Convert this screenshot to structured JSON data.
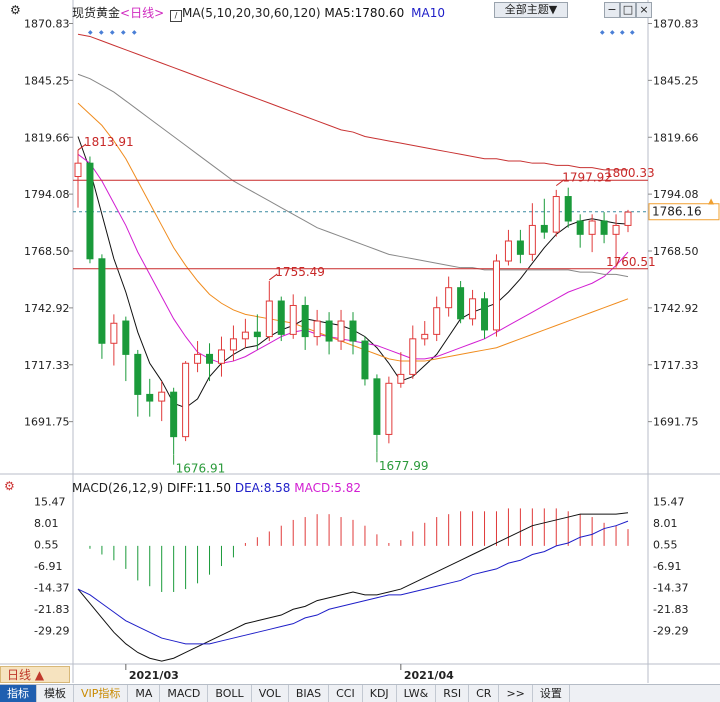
{
  "header": {
    "symbol": "现货黄金",
    "period": "<日线>",
    "ma_label": "MA(5,10,20,30,60,120)",
    "ma5_label": "MA5:1780.60",
    "ma10_label": "MA10",
    "theme_button": "全部主题▼"
  },
  "macd_header": {
    "name": "MACD(26,12,9)",
    "diff": "DIFF:11.50",
    "dea": "DEA:8.58",
    "macd": "MACD:5.82"
  },
  "period_button": "日线",
  "tabs": [
    "指标",
    "模板",
    "VIP指标",
    "MA",
    "MACD",
    "BOLL",
    "VOL",
    "BIAS",
    "CCI",
    "KDJ",
    "LW&",
    "RSI",
    "CR",
    ">>",
    "设置"
  ],
  "colors": {
    "up": "#e03a3a",
    "down": "#1a9a3a",
    "ma5": "#111111",
    "ma10": "#d21ed2",
    "ma20": "#f08c1e",
    "ma60": "#888888",
    "ma120": "#c83232",
    "dea": "#1e1ec8",
    "diff": "#111111"
  },
  "chart_data": [
    {
      "type": "candlestick",
      "title": "现货黄金 日线",
      "y_ticks_left": [
        "1870.83",
        "1845.25",
        "1819.66",
        "1794.08",
        "1768.50",
        "1742.92",
        "1717.33",
        "1691.75"
      ],
      "y_ticks_right": [
        "1870.83",
        "1845.25",
        "1819.66",
        "1794.08",
        "1768.50",
        "1742.92",
        "1717.33",
        "1691.75"
      ],
      "ylim": [
        1670,
        1876
      ],
      "x_labels": [
        {
          "label": "2021/03",
          "index": 4
        },
        {
          "label": "2021/04",
          "index": 27
        }
      ],
      "last_price": "1786.16",
      "horizontal_lines": [
        {
          "label": "1800.33",
          "value": 1800.33
        },
        {
          "label": "1760.51",
          "value": 1760.51
        }
      ],
      "annotations": [
        {
          "label": "1813.91",
          "index": 0,
          "value": 1813.91
        },
        {
          "label": "1755.49",
          "index": 16,
          "value": 1755.49
        },
        {
          "label": "1676.91",
          "index": 8,
          "value": 1676.91
        },
        {
          "label": "1677.99",
          "index": 25,
          "value": 1677.99
        },
        {
          "label": "1797.92",
          "index": 40,
          "value": 1797.92
        }
      ],
      "candles": [
        [
          1802,
          1808,
          1814,
          1788
        ],
        [
          1808,
          1765,
          1811,
          1763
        ],
        [
          1765,
          1727,
          1767,
          1720
        ],
        [
          1727,
          1736,
          1740,
          1717
        ],
        [
          1737,
          1722,
          1739,
          1710
        ],
        [
          1722,
          1704,
          1724,
          1694
        ],
        [
          1704,
          1701,
          1711,
          1694
        ],
        [
          1701,
          1705,
          1710,
          1692
        ],
        [
          1705,
          1685,
          1707,
          1677
        ],
        [
          1685,
          1718,
          1719,
          1683
        ],
        [
          1718,
          1722,
          1728,
          1714
        ],
        [
          1722,
          1718,
          1727,
          1710
        ],
        [
          1718,
          1724,
          1730,
          1712
        ],
        [
          1724,
          1729,
          1735,
          1719
        ],
        [
          1729,
          1732,
          1738,
          1725
        ],
        [
          1732,
          1730,
          1740,
          1724
        ],
        [
          1730,
          1746,
          1755,
          1728
        ],
        [
          1746,
          1731,
          1748,
          1728
        ],
        [
          1731,
          1744,
          1749,
          1729
        ],
        [
          1744,
          1730,
          1748,
          1724
        ],
        [
          1730,
          1737,
          1742,
          1726
        ],
        [
          1737,
          1728,
          1741,
          1722
        ],
        [
          1728,
          1737,
          1742,
          1724
        ],
        [
          1737,
          1728,
          1741,
          1722
        ],
        [
          1728,
          1711,
          1730,
          1708
        ],
        [
          1711,
          1686,
          1713,
          1678
        ],
        [
          1686,
          1709,
          1712,
          1682
        ],
        [
          1709,
          1713,
          1723,
          1707
        ],
        [
          1713,
          1729,
          1735,
          1711
        ],
        [
          1729,
          1731,
          1737,
          1726
        ],
        [
          1731,
          1743,
          1748,
          1728
        ],
        [
          1743,
          1752,
          1757,
          1739
        ],
        [
          1752,
          1738,
          1755,
          1736
        ],
        [
          1738,
          1747,
          1751,
          1735
        ],
        [
          1747,
          1733,
          1750,
          1729
        ],
        [
          1733,
          1764,
          1767,
          1730
        ],
        [
          1764,
          1773,
          1778,
          1762
        ],
        [
          1773,
          1767,
          1778,
          1763
        ],
        [
          1767,
          1780,
          1790,
          1764
        ],
        [
          1780,
          1777,
          1792,
          1774
        ],
        [
          1777,
          1793,
          1796,
          1775
        ],
        [
          1793,
          1782,
          1797,
          1779
        ],
        [
          1782,
          1776,
          1785,
          1770
        ],
        [
          1776,
          1782,
          1785,
          1768
        ],
        [
          1782,
          1776,
          1786,
          1772
        ],
        [
          1776,
          1780,
          1785,
          1761
        ],
        [
          1780,
          1786,
          1787,
          1777
        ]
      ],
      "series": [
        {
          "name": "MA5",
          "color_key": "ma5",
          "values": [
            1820,
            1805,
            1785,
            1765,
            1750,
            1732,
            1718,
            1710,
            1700,
            1698,
            1702,
            1712,
            1718,
            1722,
            1725,
            1726,
            1730,
            1733,
            1735,
            1738,
            1737,
            1736,
            1735,
            1733,
            1730,
            1725,
            1718,
            1710,
            1712,
            1717,
            1722,
            1730,
            1738,
            1741,
            1743,
            1745,
            1750,
            1756,
            1763,
            1770,
            1776,
            1780,
            1782,
            1783,
            1782,
            1781,
            1780.6
          ]
        },
        {
          "name": "MA10",
          "color_key": "ma10",
          "values": [
            1812,
            1808,
            1800,
            1790,
            1780,
            1768,
            1758,
            1748,
            1738,
            1730,
            1723,
            1720,
            1718,
            1719,
            1721,
            1724,
            1727,
            1730,
            1732,
            1733,
            1731,
            1730,
            1729,
            1728,
            1727,
            1726,
            1724,
            1722,
            1720,
            1720,
            1721,
            1723,
            1725,
            1727,
            1729,
            1732,
            1735,
            1738,
            1741,
            1744,
            1747,
            1750,
            1752,
            1754,
            1757,
            1762,
            1768
          ]
        },
        {
          "name": "MA20",
          "color_key": "ma20",
          "values": [
            1835,
            1830,
            1825,
            1818,
            1810,
            1800,
            1790,
            1780,
            1770,
            1762,
            1755,
            1749,
            1745,
            1742,
            1740,
            1739,
            1738,
            1737,
            1736,
            1734,
            1732,
            1730,
            1728,
            1726,
            1724,
            1722,
            1720,
            1719,
            1719,
            1719,
            1720,
            1721,
            1722,
            1723,
            1724,
            1725,
            1727,
            1729,
            1731,
            1733,
            1735,
            1737,
            1739,
            1741,
            1743,
            1745,
            1747
          ]
        },
        {
          "name": "MA60",
          "color_key": "ma60",
          "values": [
            1848,
            1846,
            1843,
            1840,
            1836,
            1832,
            1828,
            1824,
            1820,
            1816,
            1812,
            1808,
            1804,
            1800,
            1797,
            1794,
            1791,
            1788,
            1785,
            1782,
            1779,
            1777,
            1775,
            1773,
            1771,
            1769,
            1767,
            1766,
            1765,
            1764,
            1763,
            1762,
            1761,
            1761,
            1760,
            1760,
            1760,
            1760,
            1760,
            1760,
            1760,
            1760,
            1759,
            1759,
            1758,
            1758,
            1757
          ]
        },
        {
          "name": "MA120",
          "color_key": "ma120",
          "values": [
            1866,
            1865,
            1863,
            1861,
            1859,
            1857,
            1855,
            1853,
            1851,
            1849,
            1847,
            1845,
            1843,
            1841,
            1839,
            1837,
            1835,
            1833,
            1831,
            1829,
            1827,
            1825,
            1823,
            1822,
            1820,
            1819,
            1818,
            1817,
            1816,
            1815,
            1814,
            1813,
            1812,
            1811,
            1810,
            1810,
            1809,
            1809,
            1808,
            1808,
            1807,
            1807,
            1806,
            1806,
            1805,
            1805,
            1805
          ]
        }
      ]
    },
    {
      "type": "macd",
      "title": "MACD(26,12,9)",
      "y_ticks_left": [
        "15.47",
        "8.01",
        "0.55",
        "-6.91",
        "-14.37",
        "-21.83",
        "-29.29"
      ],
      "y_ticks_right": [
        "15.47",
        "8.01",
        "0.55",
        "-6.91",
        "-14.37",
        "-21.83",
        "-29.29"
      ],
      "ylim": [
        -41,
        18
      ],
      "histogram": [
        0,
        -1,
        -3,
        -5,
        -8,
        -12,
        -14,
        -16,
        -16,
        -15,
        -13,
        -10,
        -7,
        -4,
        1,
        3,
        5,
        7,
        9,
        10,
        11,
        11,
        10,
        9,
        7,
        4,
        1,
        2,
        5,
        8,
        10,
        11,
        12,
        12,
        12,
        12,
        13,
        13,
        13,
        13,
        13,
        12,
        11,
        10,
        8,
        7,
        5.82
      ],
      "series": [
        {
          "name": "DIFF",
          "color_key": "diff",
          "values": [
            -15,
            -20,
            -25,
            -30,
            -34,
            -37,
            -39,
            -40,
            -39,
            -37,
            -35,
            -33,
            -31,
            -29,
            -27,
            -26,
            -25,
            -24,
            -22,
            -21,
            -19,
            -18,
            -17,
            -16,
            -17,
            -17,
            -16,
            -15,
            -13,
            -11,
            -9,
            -7,
            -5,
            -3,
            -1,
            1,
            3,
            5,
            7,
            8,
            9,
            10,
            11,
            11,
            11,
            11,
            11.5
          ]
        },
        {
          "name": "DEA",
          "color_key": "dea",
          "values": [
            -15,
            -17,
            -20,
            -23,
            -26,
            -28,
            -30,
            -32,
            -33,
            -34,
            -34,
            -34,
            -33,
            -32,
            -31,
            -30,
            -29,
            -28,
            -27,
            -25,
            -24,
            -22,
            -21,
            -20,
            -19,
            -18,
            -17,
            -17,
            -16,
            -15,
            -14,
            -13,
            -12,
            -10,
            -9,
            -8,
            -6,
            -5,
            -3,
            -2,
            0,
            1,
            3,
            4,
            6,
            7,
            8.58
          ]
        }
      ]
    }
  ]
}
